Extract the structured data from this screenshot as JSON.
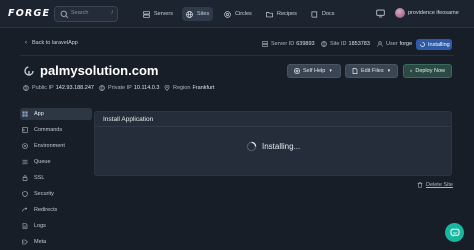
{
  "topbar": {
    "logo": "FORGE",
    "search_placeholder": "Search",
    "search_shortcut": "/",
    "nav": [
      {
        "label": "Servers",
        "icon": "server-icon"
      },
      {
        "label": "Sites",
        "icon": "globe-icon",
        "active": true
      },
      {
        "label": "Circles",
        "icon": "circles-icon"
      },
      {
        "label": "Recipes",
        "icon": "folder-icon"
      },
      {
        "label": "Docs",
        "icon": "book-icon"
      }
    ],
    "user_name": "providence ifeosame"
  },
  "header": {
    "back_label": "Back to laravelApp",
    "server_id_label": "Server ID",
    "server_id": "639893",
    "site_id_label": "Site ID",
    "site_id": "1853783",
    "user_label": "User",
    "user": "forge",
    "status": "Installing"
  },
  "site": {
    "title": "palmysolution.com",
    "buttons": {
      "self_help": "Self Help",
      "edit_files": "Edit Files",
      "deploy_now": "Deploy Now"
    },
    "public_ip_label": "Public IP",
    "public_ip": "142.93.188.247",
    "private_ip_label": "Private IP",
    "private_ip": "10.114.0.3",
    "region_label": "Region",
    "region": "Frankfurt"
  },
  "sidebar": {
    "items": [
      {
        "label": "App",
        "icon": "app-icon",
        "active": true
      },
      {
        "label": "Commands",
        "icon": "terminal-icon"
      },
      {
        "label": "Environment",
        "icon": "environment-icon"
      },
      {
        "label": "Queue",
        "icon": "queue-icon"
      },
      {
        "label": "SSL",
        "icon": "lock-icon"
      },
      {
        "label": "Security",
        "icon": "shield-icon"
      },
      {
        "label": "Redirects",
        "icon": "redirect-icon"
      },
      {
        "label": "Logs",
        "icon": "logs-icon"
      },
      {
        "label": "Meta",
        "icon": "meta-icon"
      }
    ]
  },
  "panel": {
    "title": "Install Application",
    "status_text": "Installing..."
  },
  "footer": {
    "delete_label": "Delete Site"
  },
  "colors": {
    "background": "#171e28",
    "accent_blue": "#2f5aa8",
    "chat_teal": "#18b7a0"
  }
}
